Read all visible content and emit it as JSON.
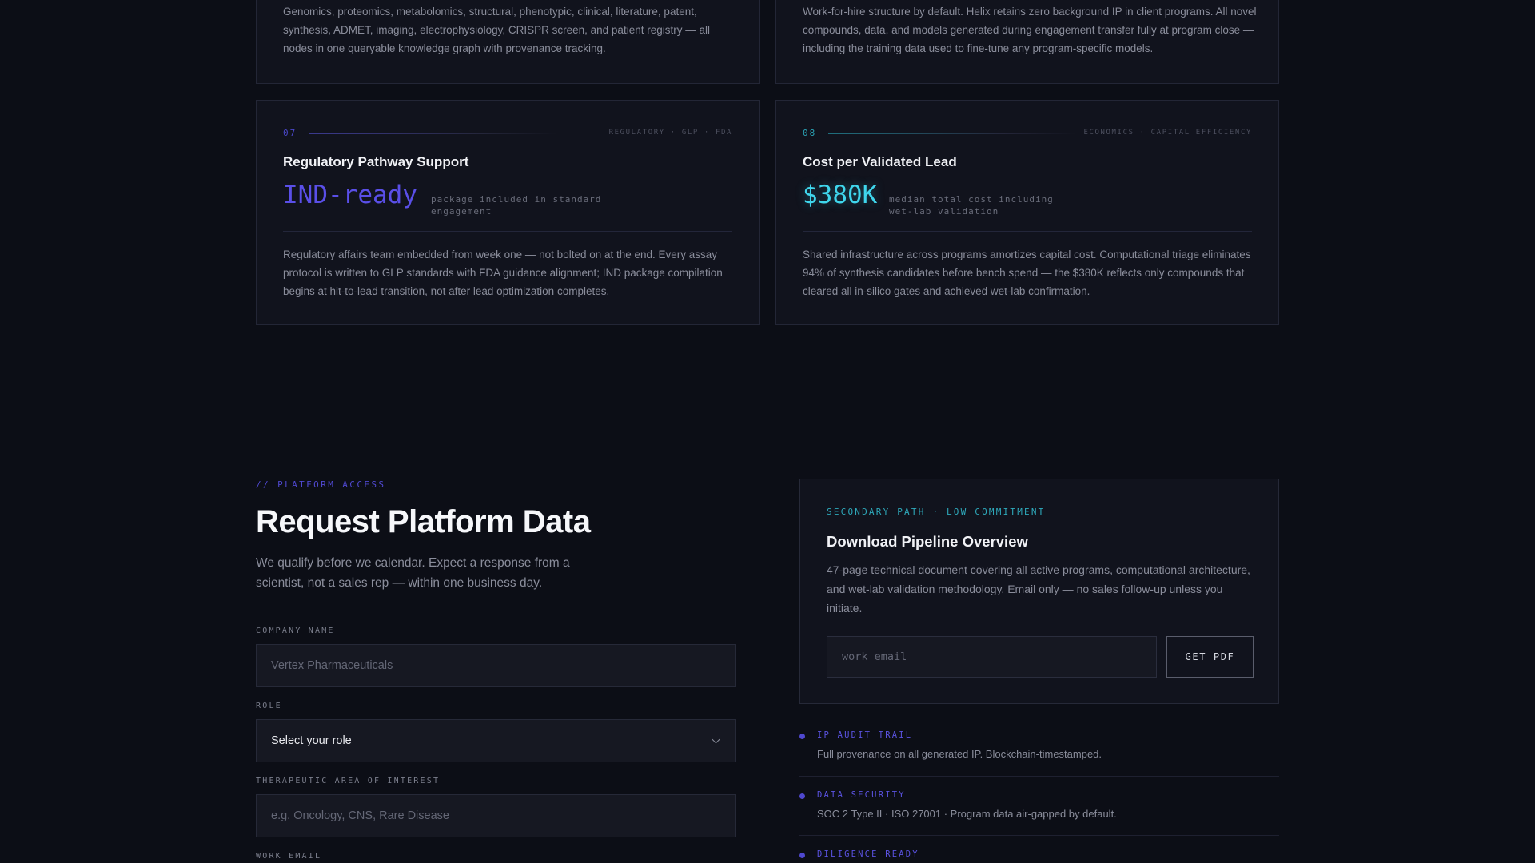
{
  "cards_top": [
    {
      "body": "Genomics, proteomics, metabolomics, structural, phenotypic, clinical, literature, patent, synthesis, ADMET, imaging, electrophysiology, CRISPR screen, and patient registry — all nodes in one queryable knowledge graph with provenance tracking."
    },
    {
      "body": "Work-for-hire structure by default. Helix retains zero background IP in client programs. All novel compounds, data, and models generated during engagement transfer fully at program close — including the training data used to fine-tune any program-specific models."
    }
  ],
  "cards": [
    {
      "number": "07",
      "tags": "REGULATORY · GLP · FDA",
      "title": "Regulatory Pathway Support",
      "stat_value": "IND-ready",
      "stat_note": "package included in standard engagement",
      "body": "Regulatory affairs team embedded from week one — not bolted on at the end. Every assay protocol is written to GLP standards with FDA guidance alignment; IND package compilation begins at hit-to-lead transition, not after lead optimization completes."
    },
    {
      "number": "08",
      "tags": "ECONOMICS · CAPITAL EFFICIENCY",
      "title": "Cost per Validated Lead",
      "stat_value": "$380K",
      "stat_note": "median total cost including wet-lab validation",
      "body": "Shared infrastructure across programs amortizes capital cost. Computational triage eliminates 94% of synthesis candidates before bench spend — the $380K reflects only compounds that cleared all in-silico gates and achieved wet-lab confirmation."
    }
  ],
  "request": {
    "eyebrow": "// PLATFORM ACCESS",
    "title": "Request Platform Data",
    "subtitle": "We qualify before we calendar. Expect a response from a scientist, not a sales rep — within one business day.",
    "company_label": "COMPANY NAME",
    "company_placeholder": "Vertex Pharmaceuticals",
    "role_label": "ROLE",
    "role_value": "Select your role",
    "area_label": "THERAPEUTIC AREA OF INTEREST",
    "area_placeholder": "e.g. Oncology, CNS, Rare Disease",
    "email_label": "WORK EMAIL"
  },
  "pdf": {
    "eyebrow": "SECONDARY PATH · LOW COMMITMENT",
    "title": "Download Pipeline Overview",
    "description": "47-page technical document covering all active programs, computational architecture, and wet-lab validation methodology. Email only — no sales follow-up unless you initiate.",
    "email_placeholder": "work email",
    "button_label": "GET PDF"
  },
  "trust": [
    {
      "title": "IP AUDIT TRAIL",
      "description": "Full provenance on all generated IP. Blockchain-timestamped."
    },
    {
      "title": "DATA SECURITY",
      "description": "SOC 2 Type II · ISO 27001 · Program data air-gapped by default."
    },
    {
      "title": "DILIGENCE READY",
      "description": ""
    }
  ],
  "colors": {
    "background": "#0c0e16",
    "card": "#11131d",
    "accent_violet": "#5a4fe8",
    "accent_cyan": "#3fd6ec"
  }
}
